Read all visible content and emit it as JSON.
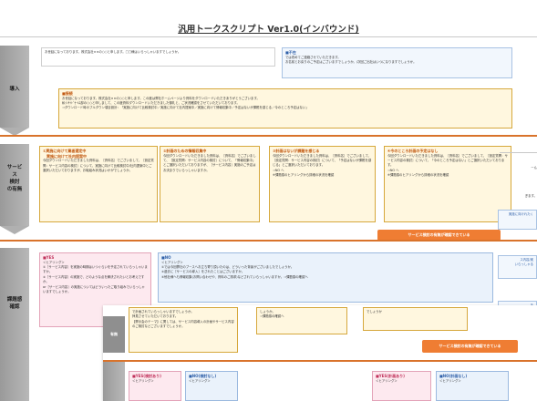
{
  "page": {
    "title": "汎用トークスクリプト  Ver1.0(インバウンド)"
  },
  "intro": {
    "side_label": "導入",
    "greeting_text": "お世話になっております。株式会社××の○○と申します。□□様はいらっしゃいますでしょうか。",
    "absent": {
      "heading": "■不在",
      "text": "では改めてご連絡させていただきます。\nお名前とお戻りのご予定はございますでしょうか。/次回ご出社はいつになりますでしょうか。"
    },
    "connected": {
      "heading": "■接続",
      "text": "お世話になっております。株式会社××の○○と申します。この度は弊社ホームページより資料をダウンロードいただきありがとうございます。\n私ｲﾝｻｲﾄﾞｾｰﾙｽ部の○○と申しまして、この度資料ダウンロードいただきました御礼と、ご状況確認をさせていただいております。\n⇒ダウンロード時のプルダウン項目設計：「実施に向けて比較検討中／実施に向けて社内提案中／実施に向けて情報収集中／予定はないが課題を感じる／今のところ予定はない」"
    }
  },
  "consider": {
    "side_label": "サービ\nス\n検討\nの有無",
    "cards": [
      {
        "heading": "①実施に向けて業者選定中\n　実施に向けて社内提案中",
        "text": "今回ダウンロードいただきました資料は、［資料名］でございまして、［設定質問：サービス内容の検討］について、実施に向けて比較検討中/社内提案中とご選択いただいておりますが、お取組み状況はいかがでしょうか。"
      },
      {
        "heading": "②計画のための情報収集中",
        "text": "今回ダウンロードいただきました資料は、［資料名］でございまして、［設定質問：サービス内容の検討］について、「情報収集中」とご選択いただいておりますが、［サービス内容］実施のご予定はお決まりでいらっしゃいますか。"
      },
      {
        "heading": "③計画はないが課題を感じる",
        "text": "今回ダウンロードいただきました資料は、［資料名］でございまして、［設定質問：サービス内容の検討］について、「予定はないが課題を感じる」とご選択いただいております。\n⇒NO へ\n※課題感のヒアリングから詳細の状況を確認"
      },
      {
        "heading": "④今のところ計画の予定はなし",
        "text": "今回ダウンロードいただきました資料は、［資料名］でございまして、［設定質問：サービス内容の検討］について、「今のところ予定はない」とご選択いただいております。\n⇒NO へ\n※課題感のヒアリングから詳細の状況を確認"
      }
    ],
    "confirm_pill": "サービス検討の有無が確認できている"
  },
  "issues": {
    "side_label": "課題感\n確認",
    "yes": {
      "heading": "■YES",
      "text": "＜ヒアリング＞\n①［サービス内容］を実施の時期はいつぐらいを予定されていらっしゃいますか。\n②［サービス内容］の実施で、どのような点を解決されたいとお考えですか。\nor［サービス内容］の実施についてはどういったご取り組みでいらっしゃいますでしょうか。"
    },
    "no": {
      "heading": "■NO",
      "text": "＜ヒアリング＞\n①では今回弊社のブースへお立ち寄り頂いたのは、どういった背景がございましたでしょうか。\n②過去に［サービスの導入］をされたことはございますか。\n③他社様へも情報収集(お問い合わせや、資料のご請求)などされていらっしゃいますか。⇒課題感の確認へ"
    }
  },
  "overlay": {
    "side_label": "有無",
    "left_text": "で計画されていらっしゃいますでしょうか。\n拝見させていただいております。\n【弊示会のテーマ】に関しては、サービス内容導入の計画やサービス内容のご検討などございますでしょうか。",
    "mid_text": "しょうか。\n⇒課題感の確認へ",
    "right_text": "でしょうか",
    "pill": "サービス検討の有無が確認できている",
    "bottom_cards": [
      {
        "heading": "■YES(検討あり)",
        "text": "＜ヒアリング＞"
      },
      {
        "heading": "■NO(検討なし)",
        "text": "＜ヒアリング＞"
      },
      {
        "heading": "■YES(計画あり)",
        "text": "＜ヒアリング＞"
      },
      {
        "heading": "■NO(計画なし)",
        "text": "＜ヒアリング＞"
      }
    ]
  },
  "right_clip": {
    "text_a": "ーん",
    "text_b": "ぎます。",
    "text_c": "実施に向けれたく",
    "text_d": "ス内容/実\nいらっしゃる",
    "text_e": "あ"
  }
}
